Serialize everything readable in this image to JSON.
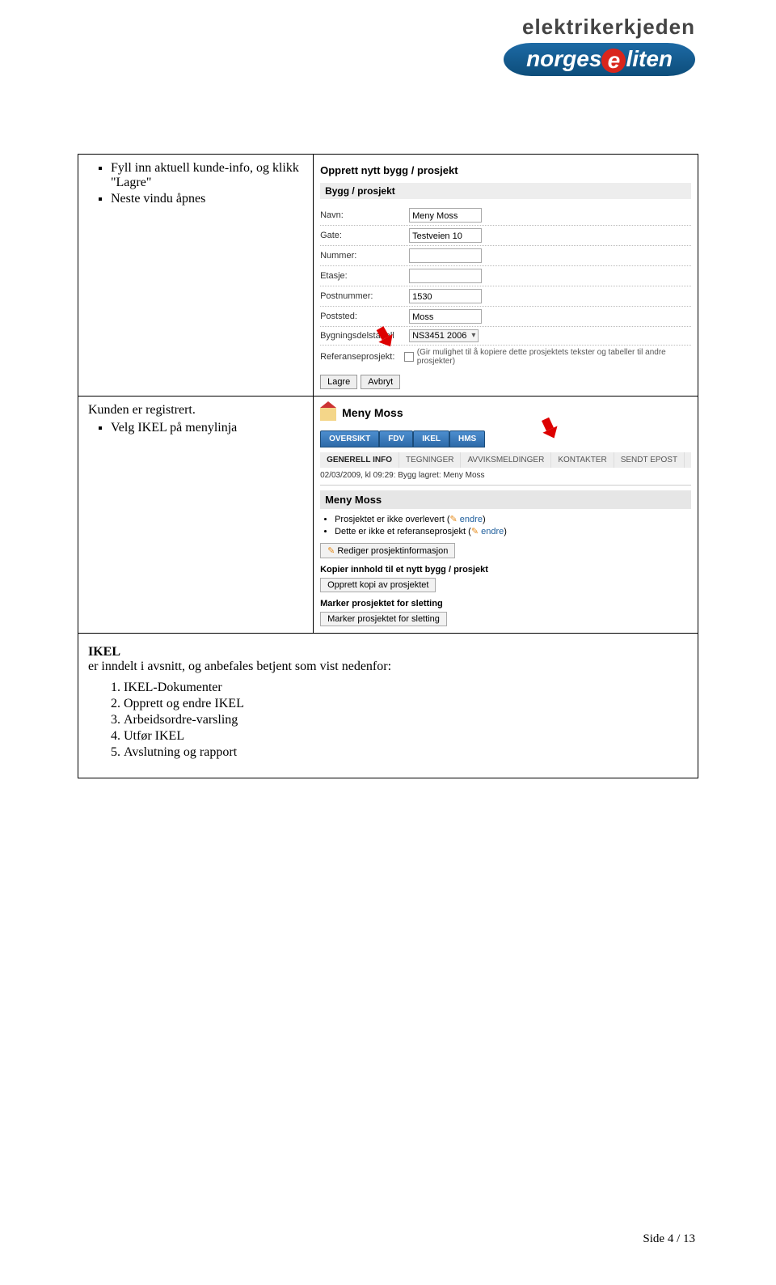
{
  "logo": {
    "top": "elektrikerkjeden",
    "bottom_left": "norges",
    "bottom_right": "liten",
    "bottom_e": "e"
  },
  "row1": {
    "bullets": [
      "Fyll inn aktuell kunde-info, og klikk \"Lagre\"",
      "Neste vindu åpnes"
    ],
    "form": {
      "title": "Opprett nytt bygg / prosjekt",
      "section": "Bygg / prosjekt",
      "fields": {
        "navn_label": "Navn:",
        "navn_value": "Meny Moss",
        "gate_label": "Gate:",
        "gate_value": "Testveien 10",
        "nummer_label": "Nummer:",
        "nummer_value": "",
        "etasje_label": "Etasje:",
        "etasje_value": "",
        "postnummer_label": "Postnummer:",
        "postnummer_value": "1530",
        "poststed_label": "Poststed:",
        "poststed_value": "Moss",
        "delstabell_label": "Bygningsdelstabell",
        "delstabell_value": "NS3451 2006",
        "ref_label": "Referanseprosjekt:",
        "ref_note": "(Gir mulighet til å kopiere dette prosjektets tekster og tabeller til andre prosjekter)"
      },
      "buttons": {
        "lagre": "Lagre",
        "avbryt": "Avbryt"
      }
    }
  },
  "row2": {
    "text1": "Kunden er registrert.",
    "bullet": "Velg IKEL på menylinja",
    "proj": {
      "name": "Meny Moss",
      "tabs": [
        "OVERSIKT",
        "FDV",
        "IKEL",
        "HMS"
      ],
      "subtabs": [
        "GENERELL INFO",
        "TEGNINGER",
        "AVVIKSMELDINGER",
        "KONTAKTER",
        "SENDT EPOST"
      ],
      "status": "02/03/2009, kl 09:29: Bygg lagret: Meny Moss",
      "heading": "Meny Moss",
      "lines": [
        "Prosjektet er ikke overlevert (📝 endre)",
        "Dette er ikke et referanseprosjekt (📝 endre)"
      ],
      "edit_btn": "Rediger prosjektinformasjon",
      "section_copy": "Kopier innhold til et nytt bygg / prosjekt",
      "copy_btn": "Opprett kopi av prosjektet",
      "section_delete": "Marker prosjektet for sletting",
      "delete_btn": "Marker prosjektet for sletting"
    }
  },
  "row3": {
    "title": "IKEL",
    "intro": "er inndelt i avsnitt, og anbefales betjent som vist nedenfor:",
    "items": [
      "IKEL-Dokumenter",
      "Opprett og endre IKEL",
      "Arbeidsordre-varsling",
      "Utfør IKEL",
      "Avslutning og rapport"
    ]
  },
  "footer": "Side 4 / 13"
}
